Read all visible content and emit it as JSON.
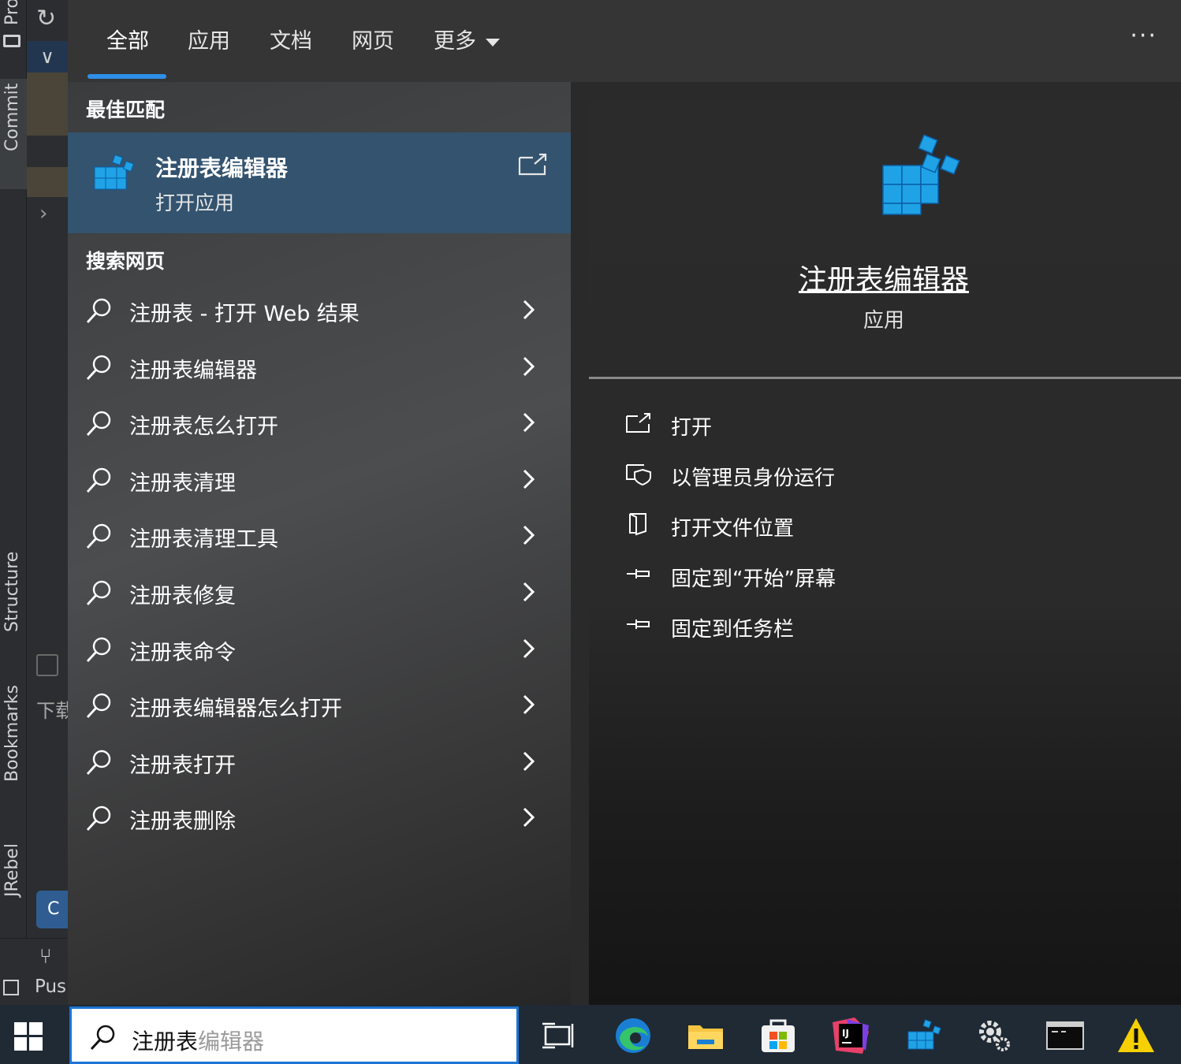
{
  "ide": {
    "vertical_labels": [
      "Pro",
      "Commit",
      "Structure",
      "Bookmarks",
      "JRebel"
    ],
    "panel_text": "下载",
    "bottom_label": "Pus"
  },
  "tabs": [
    {
      "label": "全部",
      "active": true
    },
    {
      "label": "应用",
      "active": false
    },
    {
      "label": "文档",
      "active": false
    },
    {
      "label": "网页",
      "active": false
    },
    {
      "label": "更多",
      "active": false
    }
  ],
  "more_menu": "···",
  "best_match": {
    "section_title": "最佳匹配",
    "name": "注册表编辑器",
    "subtitle": "打开应用",
    "icon": "registry-editor-icon"
  },
  "web_search": {
    "section_title": "搜索网页",
    "items": [
      "注册表 - 打开 Web 结果",
      "注册表编辑器",
      "注册表怎么打开",
      "注册表清理",
      "注册表清理工具",
      "注册表修复",
      "注册表命令",
      "注册表编辑器怎么打开",
      "注册表打开",
      "注册表删除"
    ]
  },
  "details": {
    "title": "注册表编辑器",
    "subtitle": "应用",
    "actions": [
      {
        "label": "打开",
        "icon": "open-icon"
      },
      {
        "label": "以管理员身份运行",
        "icon": "shield-icon"
      },
      {
        "label": "打开文件位置",
        "icon": "file-location-icon"
      },
      {
        "label": "固定到“开始”屏幕",
        "icon": "pin-icon"
      },
      {
        "label": "固定到任务栏",
        "icon": "pin-icon"
      }
    ]
  },
  "taskbar": {
    "search_typed": "注册表",
    "search_suggestion": "编辑器",
    "apps": [
      "task-view-icon",
      "edge-icon",
      "file-explorer-icon",
      "store-icon",
      "intellij-icon",
      "registry-editor-icon",
      "settings-icon",
      "terminal-icon",
      "warning-icon"
    ]
  },
  "colors": {
    "accent": "#2f8fe8",
    "best_match_bg": "#33536f",
    "taskbar_bg": "#1f2a34",
    "search_border": "#1c74d4"
  }
}
